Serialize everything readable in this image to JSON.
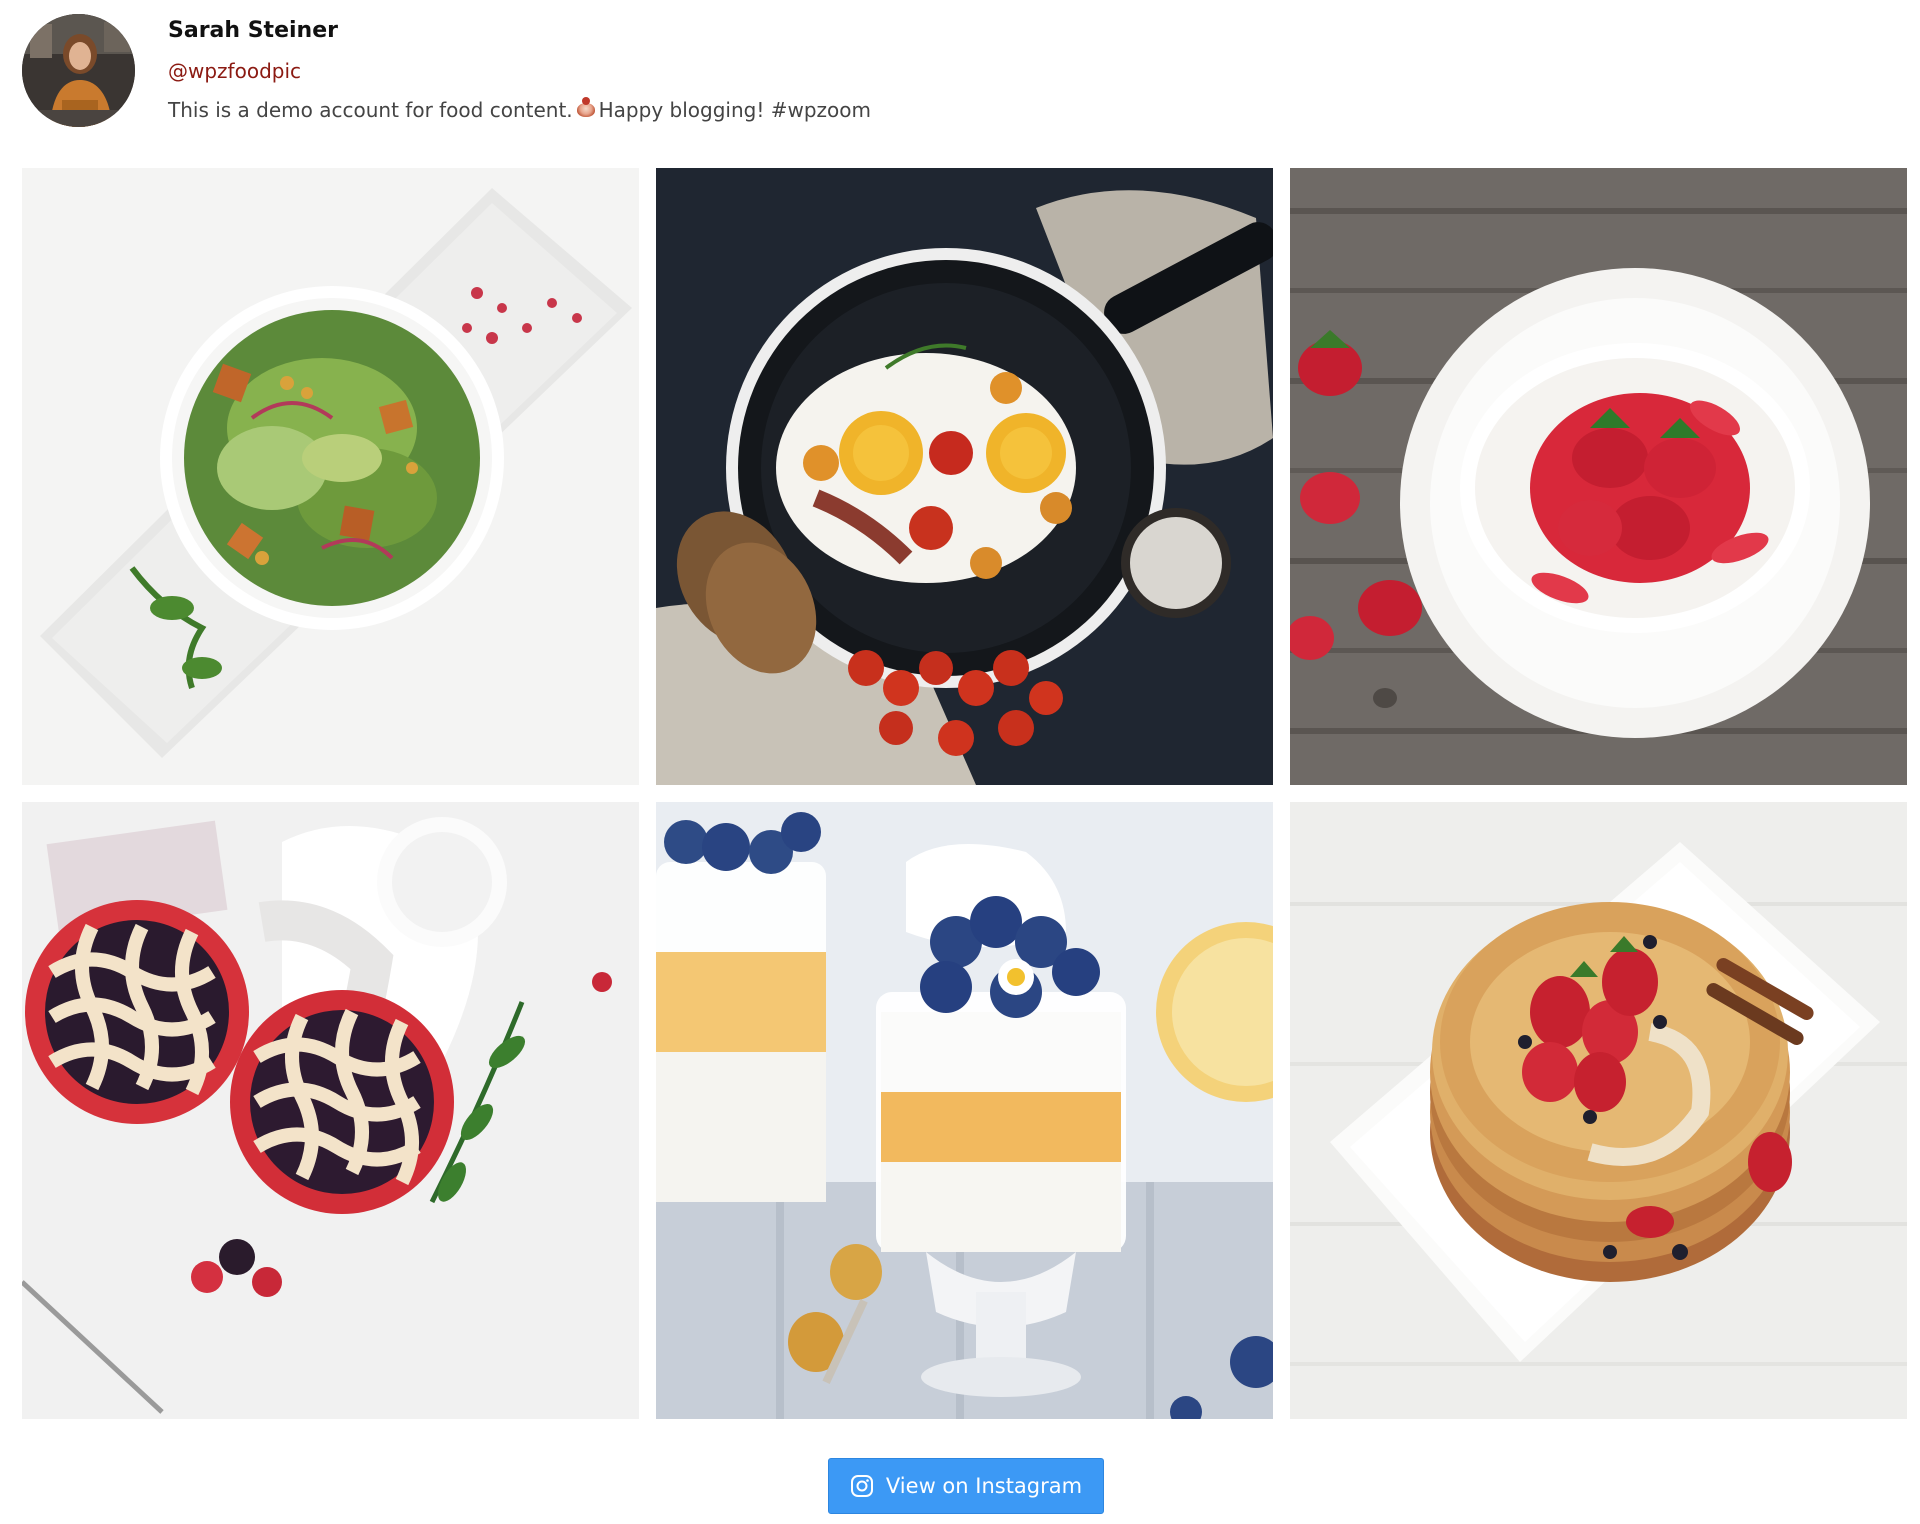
{
  "profile": {
    "name": "Sarah Steiner",
    "handle": "@wpzfoodpic",
    "bio_before": "This is a demo account for food content.",
    "bio_after": "Happy blogging! #wpzoom",
    "bio_emoji": "food-bowl-emoji",
    "handle_color": "#8b1a12"
  },
  "feed": {
    "columns": 3,
    "rows": 2,
    "images": [
      {
        "subject": "salad-bowl-photo"
      },
      {
        "subject": "fried-eggs-pan-photo"
      },
      {
        "subject": "strawberry-pavlova-photo"
      },
      {
        "subject": "berry-pies-photo"
      },
      {
        "subject": "blueberry-parfait-photo"
      },
      {
        "subject": "strawberry-pancakes-photo"
      }
    ]
  },
  "button": {
    "label": "View on Instagram",
    "icon": "instagram-icon",
    "color": "#3c99f5"
  }
}
